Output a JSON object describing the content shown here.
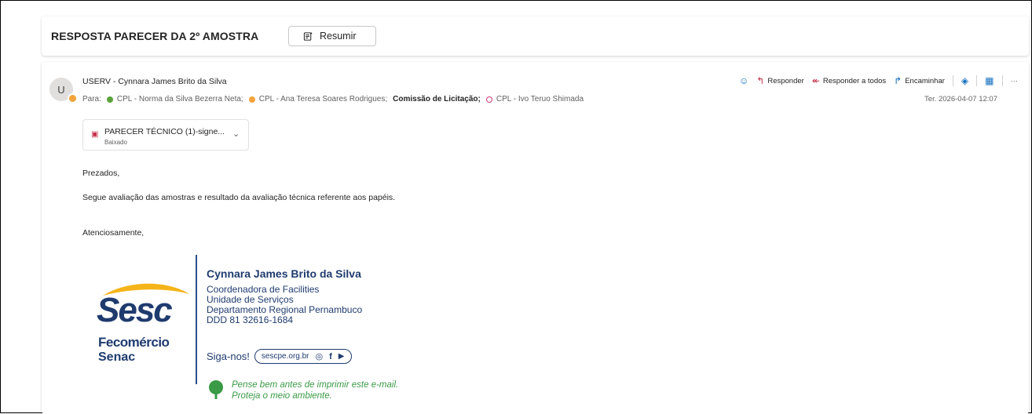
{
  "header": {
    "subject": "RESPOSTA PARECER DA 2º AMOSTRA",
    "summarize_label": "Resumir"
  },
  "message": {
    "avatar_initial": "U",
    "sender": "USERV - Cynnara James Brito da Silva",
    "to_label": "Para:",
    "recipients": [
      {
        "name": "CPL - Norma da Silva Bezerra Neta;",
        "status": "green"
      },
      {
        "name": "CPL - Ana Teresa Soares Rodrigues;",
        "status": "orange"
      },
      {
        "name": "Comissão de Licitação;",
        "status": "none"
      },
      {
        "name": "CPL - Ivo Teruo Shimada",
        "status": "pink"
      }
    ],
    "actions": {
      "reply": "Responder",
      "reply_all": "Responder a todos",
      "forward": "Encaminhar"
    },
    "date": "Ter. 2026-04-07 12:07",
    "attachment": {
      "name": "PARECER TÉCNICO (1)-signe...",
      "status": "Baixado"
    },
    "body": {
      "greeting": "Prezados,",
      "line1": "Segue avaliação das amostras e resultado da avaliação técnica referente aos papéis.",
      "closing": "Atenciosamente,"
    },
    "signature": {
      "logo_text_main": "Sesc",
      "logo_text_sub1": "Fecomércio",
      "logo_text_sub2": "Senac",
      "name": "Cynnara James Brito da Silva",
      "role1": "Coordenadora de Facilities",
      "role2": "Unidade de Serviços",
      "role3": "Departamento Regional Pernambuco",
      "phone": "DDD 81 32616-1684",
      "follow": "Siga-nos!",
      "site": "sescpe.org.br",
      "eco1": "Pense bem antes de imprimir este e-mail.",
      "eco2": "Proteja o meio ambiente."
    }
  },
  "colors": {
    "accent": "#0f6cbd",
    "brand_blue": "#1f3b6e",
    "brand_yellow": "#f4b41a",
    "eco_green": "#3a9a46"
  }
}
